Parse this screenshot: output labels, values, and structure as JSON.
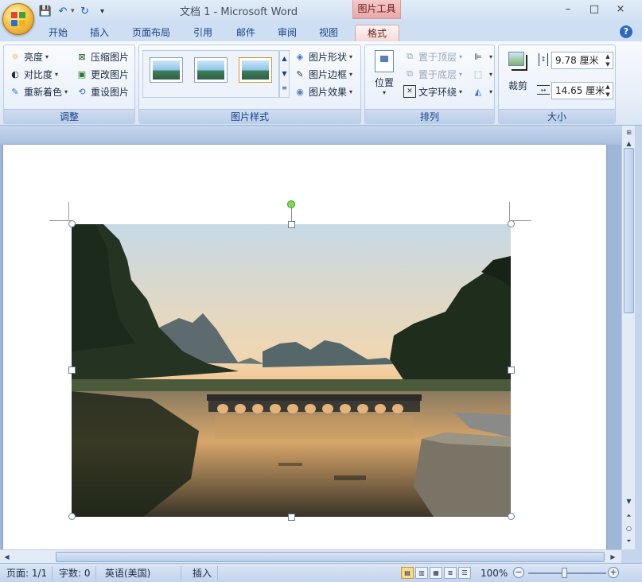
{
  "window": {
    "title": "文档 1 - Microsoft Word",
    "context_tab": "图片工具",
    "minimize": "–",
    "maximize": "□",
    "close": "×"
  },
  "qat": {
    "save": "💾",
    "undo": "↶",
    "redo": "↻",
    "more": "▾"
  },
  "tabs": [
    {
      "label": "开始"
    },
    {
      "label": "插入"
    },
    {
      "label": "页面布局"
    },
    {
      "label": "引用"
    },
    {
      "label": "邮件"
    },
    {
      "label": "审阅"
    },
    {
      "label": "视图"
    },
    {
      "label": "格式",
      "active": true
    }
  ],
  "help": "?",
  "ribbon": {
    "adjust": {
      "label": "调整",
      "brightness": "亮度",
      "contrast": "对比度",
      "recolor": "重新着色",
      "compress": "压缩图片",
      "change": "更改图片",
      "reset": "重设图片"
    },
    "styles": {
      "label": "图片样式",
      "shape": "图片形状",
      "border": "图片边框",
      "effects": "图片效果"
    },
    "arrange": {
      "label": "排列",
      "position": "位置",
      "front": "置于顶层",
      "back": "置于底层",
      "wrap": "文字环绕"
    },
    "size": {
      "label": "大小",
      "crop": "裁剪",
      "height": "9.78 厘米",
      "width": "14.65 厘米"
    }
  },
  "statusbar": {
    "page": "页面: 1/1",
    "words": "字数: 0",
    "language": "英语(美国)",
    "mode": "插入",
    "zoom": "100%"
  },
  "colors": {
    "ribbon_bg": "#e7eef8",
    "accent": "#15428b",
    "context_tab": "#e8a8a8",
    "page": "#ffffff",
    "workspace": "#9eb7d9"
  }
}
